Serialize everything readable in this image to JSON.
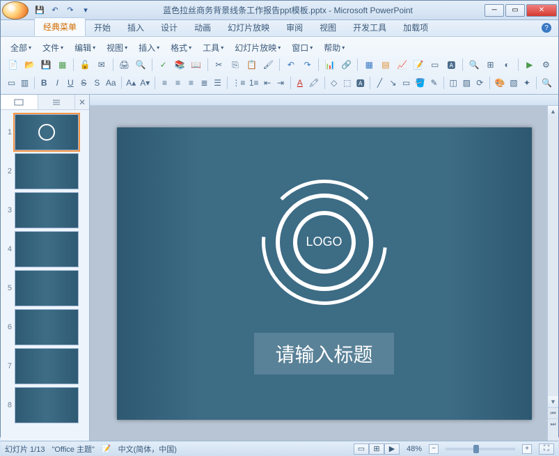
{
  "titlebar": {
    "document_name": "蓝色拉丝商务背景线条工作报告ppt模板.pptx",
    "app_name": "Microsoft PowerPoint",
    "separator": " - "
  },
  "qat": {
    "save": "💾",
    "undo": "↶",
    "redo": "↷",
    "more": "▾"
  },
  "tabs": {
    "classic": "经典菜单",
    "home": "开始",
    "insert": "插入",
    "design": "设计",
    "animation": "动画",
    "slideshow": "幻灯片放映",
    "review": "审阅",
    "view": "视图",
    "dev": "开发工具",
    "addin": "加载项"
  },
  "menus": {
    "all": "全部",
    "file": "文件",
    "edit": "编辑",
    "view": "视图",
    "insert": "插入",
    "format": "格式",
    "tools": "工具",
    "slideshow": "幻灯片放映",
    "window": "窗口",
    "help": "帮助"
  },
  "slide": {
    "logo_text": "LOGO",
    "title_placeholder": "请输入标题"
  },
  "thumbnails": {
    "count": 8,
    "active": 1
  },
  "status": {
    "slide_counter": "幻灯片 1/13",
    "theme": "\"Office 主题\"",
    "language": "中文(简体，中国)",
    "zoom": "48%"
  }
}
